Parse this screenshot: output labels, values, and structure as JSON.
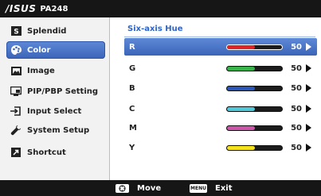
{
  "header": {
    "brand": "/ISUS",
    "model": "PA248"
  },
  "menu": {
    "items": [
      {
        "label": "Splendid",
        "icon": "splendid-icon"
      },
      {
        "label": "Color",
        "icon": "palette-icon",
        "selected": true
      },
      {
        "label": "Image",
        "icon": "image-icon"
      },
      {
        "label": "PIP/PBP Setting",
        "icon": "pip-icon"
      },
      {
        "label": "Input Select",
        "icon": "input-select-icon"
      },
      {
        "label": "System Setup",
        "icon": "wrench-icon"
      },
      {
        "label": "Shortcut",
        "icon": "shortcut-icon"
      }
    ]
  },
  "panel": {
    "title": "Six-axis Hue",
    "rows": [
      {
        "label": "R",
        "value": "50",
        "level": 0.5,
        "color": "#e02424",
        "selected": true
      },
      {
        "label": "G",
        "value": "50",
        "level": 0.5,
        "color": "#37b34a"
      },
      {
        "label": "B",
        "value": "50",
        "level": 0.5,
        "color": "#2a55b8"
      },
      {
        "label": "C",
        "value": "50",
        "level": 0.5,
        "color": "#4fc9d8"
      },
      {
        "label": "M",
        "value": "50",
        "level": 0.5,
        "color": "#cc55aa"
      },
      {
        "label": "Y",
        "value": "50",
        "level": 0.5,
        "color": "#f3e21b"
      }
    ]
  },
  "footer": {
    "move_label": "Move",
    "menu_key": "MENU",
    "exit_label": "Exit"
  },
  "colors": {
    "accent": "#3b64b9",
    "title_blue": "#2f65c6",
    "bar_bg": "#161616"
  }
}
